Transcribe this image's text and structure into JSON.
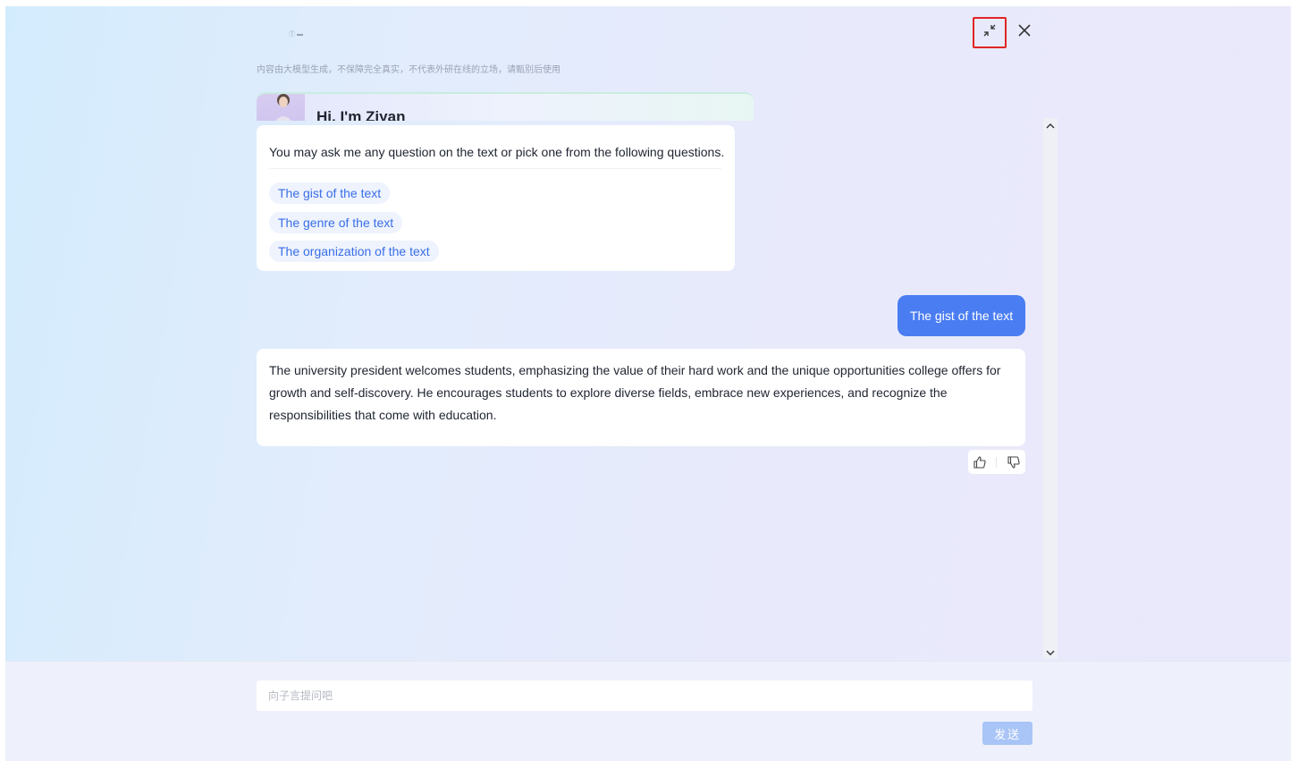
{
  "header": {
    "logo_text": "Ⓣ ▬",
    "disclaimer": "内容由大模型生成，不保障完全真实，不代表外研在线的立场，请甄别后使用",
    "collapse_icon": "collapse-arrows-icon",
    "close_icon": "close-icon"
  },
  "greeting": {
    "title": "Hi, I'm Ziyan"
  },
  "suggestions": {
    "intro": "You may ask me any question on the text or pick one from the following questions.",
    "options": [
      "The gist of the text",
      "The genre of the text",
      "The organization of the text"
    ]
  },
  "user_message": "The gist of the text",
  "answer": {
    "text": "The university president welcomes students, emphasizing the value of their hard work and the unique opportunities college offers for growth and self-discovery. He encourages students to explore diverse fields, embrace new experiences, and recognize the responsibilities that come with education.",
    "feedback_icons": [
      "thumbs-up-icon",
      "thumbs-down-icon"
    ]
  },
  "composer": {
    "placeholder": "向子言提问吧",
    "send_label": "发送"
  },
  "colors": {
    "accent": "#4a7df1",
    "chip_text": "#3a6ee8",
    "highlight_border": "#e02424",
    "send_disabled": "#a9c4f6"
  }
}
